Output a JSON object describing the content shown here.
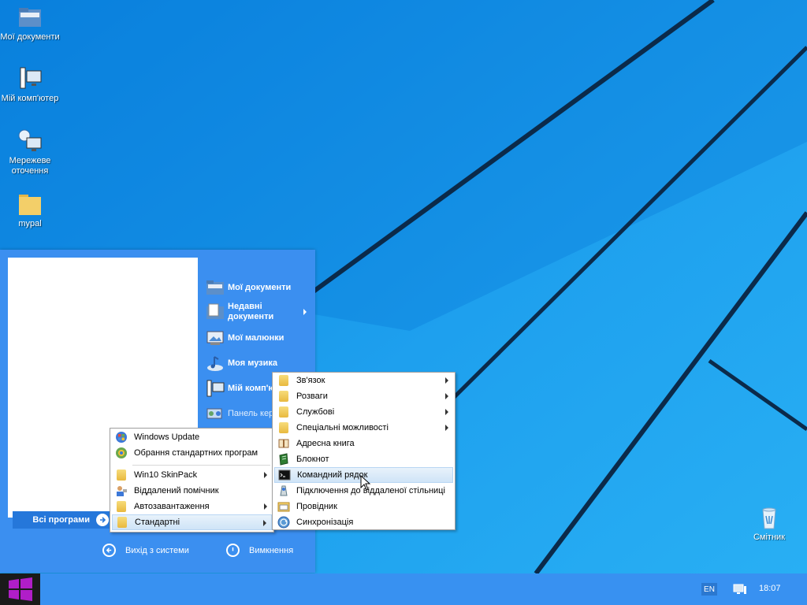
{
  "desktop": {
    "icons": [
      {
        "label": "Мої документи",
        "icon": "folder-documents-icon"
      },
      {
        "label": "Мій комп'ютер",
        "icon": "computer-icon"
      },
      {
        "label": "Мережеве оточення",
        "icon": "network-icon"
      },
      {
        "label": "mypal",
        "icon": "folder-icon"
      },
      {
        "label": "Смітник",
        "icon": "recycle-bin-icon"
      }
    ]
  },
  "start_menu": {
    "right_items": [
      {
        "label": "Мої документи",
        "icon": "documents-icon"
      },
      {
        "label": "Недавні документи",
        "icon": "recent-documents-icon",
        "submenu": true
      },
      {
        "label": "Мої малюнки",
        "icon": "pictures-icon"
      },
      {
        "label": "Моя музика",
        "icon": "music-icon"
      },
      {
        "label": "Мій комп'ютер",
        "icon": "computer-icon"
      },
      {
        "label": "Панель керування",
        "icon": "control-panel-icon"
      }
    ],
    "all_programs": "Всі програми",
    "logoff": "Вихід з системи",
    "shutdown": "Вимкнення"
  },
  "programs_menu": {
    "items": [
      {
        "label": "Windows Update",
        "icon": "windows-update-icon"
      },
      {
        "label": "Обрання стандартних програм",
        "icon": "default-programs-icon"
      },
      {
        "label": "Win10 SkinPack",
        "icon": "folder-icon",
        "submenu": true
      },
      {
        "label": "Віддалений помічник",
        "icon": "remote-assistance-icon"
      },
      {
        "label": "Автозавантаження",
        "icon": "folder-icon",
        "submenu": true
      },
      {
        "label": "Стандартні",
        "icon": "folder-icon",
        "submenu": true,
        "highlighted": true
      }
    ]
  },
  "accessories_menu": {
    "items": [
      {
        "label": "Зв'язок",
        "icon": "folder-icon",
        "submenu": true
      },
      {
        "label": "Розваги",
        "icon": "folder-icon",
        "submenu": true
      },
      {
        "label": "Службові",
        "icon": "folder-icon",
        "submenu": true
      },
      {
        "label": "Спеціальні можливості",
        "icon": "folder-icon",
        "submenu": true
      },
      {
        "label": "Адресна книга",
        "icon": "address-book-icon"
      },
      {
        "label": "Блокнот",
        "icon": "notepad-icon"
      },
      {
        "label": "Командний рядок",
        "icon": "command-prompt-icon",
        "highlighted": true
      },
      {
        "label": "Підключення до віддаленої стільниці",
        "icon": "remote-desktop-icon"
      },
      {
        "label": "Провідник",
        "icon": "explorer-icon"
      },
      {
        "label": "Синхронізація",
        "icon": "sync-icon"
      }
    ]
  },
  "taskbar": {
    "language": "EN",
    "clock": "18:07"
  },
  "colors": {
    "desktop": "#1e9ae8",
    "start_menu": "#3b8ff0",
    "taskbar": "#3891f1",
    "start_button": "#1a1a1a",
    "windows_logo": "#b01ec8"
  }
}
